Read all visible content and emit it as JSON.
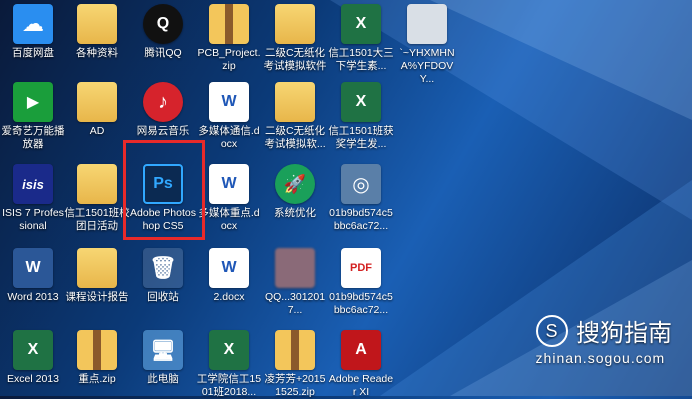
{
  "desktop": {
    "icons": [
      {
        "label": "百度网盘",
        "glyph": "☁"
      },
      {
        "label": "各种资料",
        "glyph": ""
      },
      {
        "label": "腾讯QQ",
        "glyph": "Q"
      },
      {
        "label": "PCB_Project.zip",
        "glyph": ""
      },
      {
        "label": "二级C无纸化考试模拟软件",
        "glyph": ""
      },
      {
        "label": "信工1501大三下学生素...",
        "glyph": "X"
      },
      {
        "label": "`~YHXMHNA%YFDOVY...",
        "glyph": ""
      },
      {
        "label": "爱奇艺万能播放器",
        "glyph": "▶"
      },
      {
        "label": "AD",
        "glyph": ""
      },
      {
        "label": "网易云音乐",
        "glyph": "♪"
      },
      {
        "label": "多媒体通信.docx",
        "glyph": "W"
      },
      {
        "label": "二级C无纸化考试模拟软...",
        "glyph": ""
      },
      {
        "label": "信工1501班获奖学生发...",
        "glyph": "X"
      },
      {
        "label": "ISIS 7 Professional",
        "glyph": "isis"
      },
      {
        "label": "信工1501班校团日活动",
        "glyph": ""
      },
      {
        "label": "Adobe Photoshop CS5",
        "glyph": "Ps"
      },
      {
        "label": "多媒体重点.docx",
        "glyph": "W"
      },
      {
        "label": "系统优化",
        "glyph": "🚀"
      },
      {
        "label": "01b9bd574c5bbc6ac72...",
        "glyph": "◎"
      },
      {
        "label": "Word 2013",
        "glyph": "W"
      },
      {
        "label": "课程设计报告",
        "glyph": ""
      },
      {
        "label": "回收站",
        "glyph": "🗑"
      },
      {
        "label": "2.docx",
        "glyph": "W"
      },
      {
        "label": "QQ...3012017...",
        "glyph": ""
      },
      {
        "label": "01b9bd574c5bbc6ac72...",
        "glyph": "PDF"
      },
      {
        "label": "Excel 2013",
        "glyph": "X"
      },
      {
        "label": "重点.zip",
        "glyph": ""
      },
      {
        "label": "此电脑",
        "glyph": "🖥"
      },
      {
        "label": "工学院信工1501班2018...",
        "glyph": "X"
      },
      {
        "label": "凌芳芳+20151525.zip",
        "glyph": ""
      },
      {
        "label": "Adobe Reader XI",
        "glyph": "A"
      }
    ]
  },
  "watermark": {
    "logo": "S",
    "title": "搜狗指南",
    "url": "zhinan.sogou.com"
  }
}
